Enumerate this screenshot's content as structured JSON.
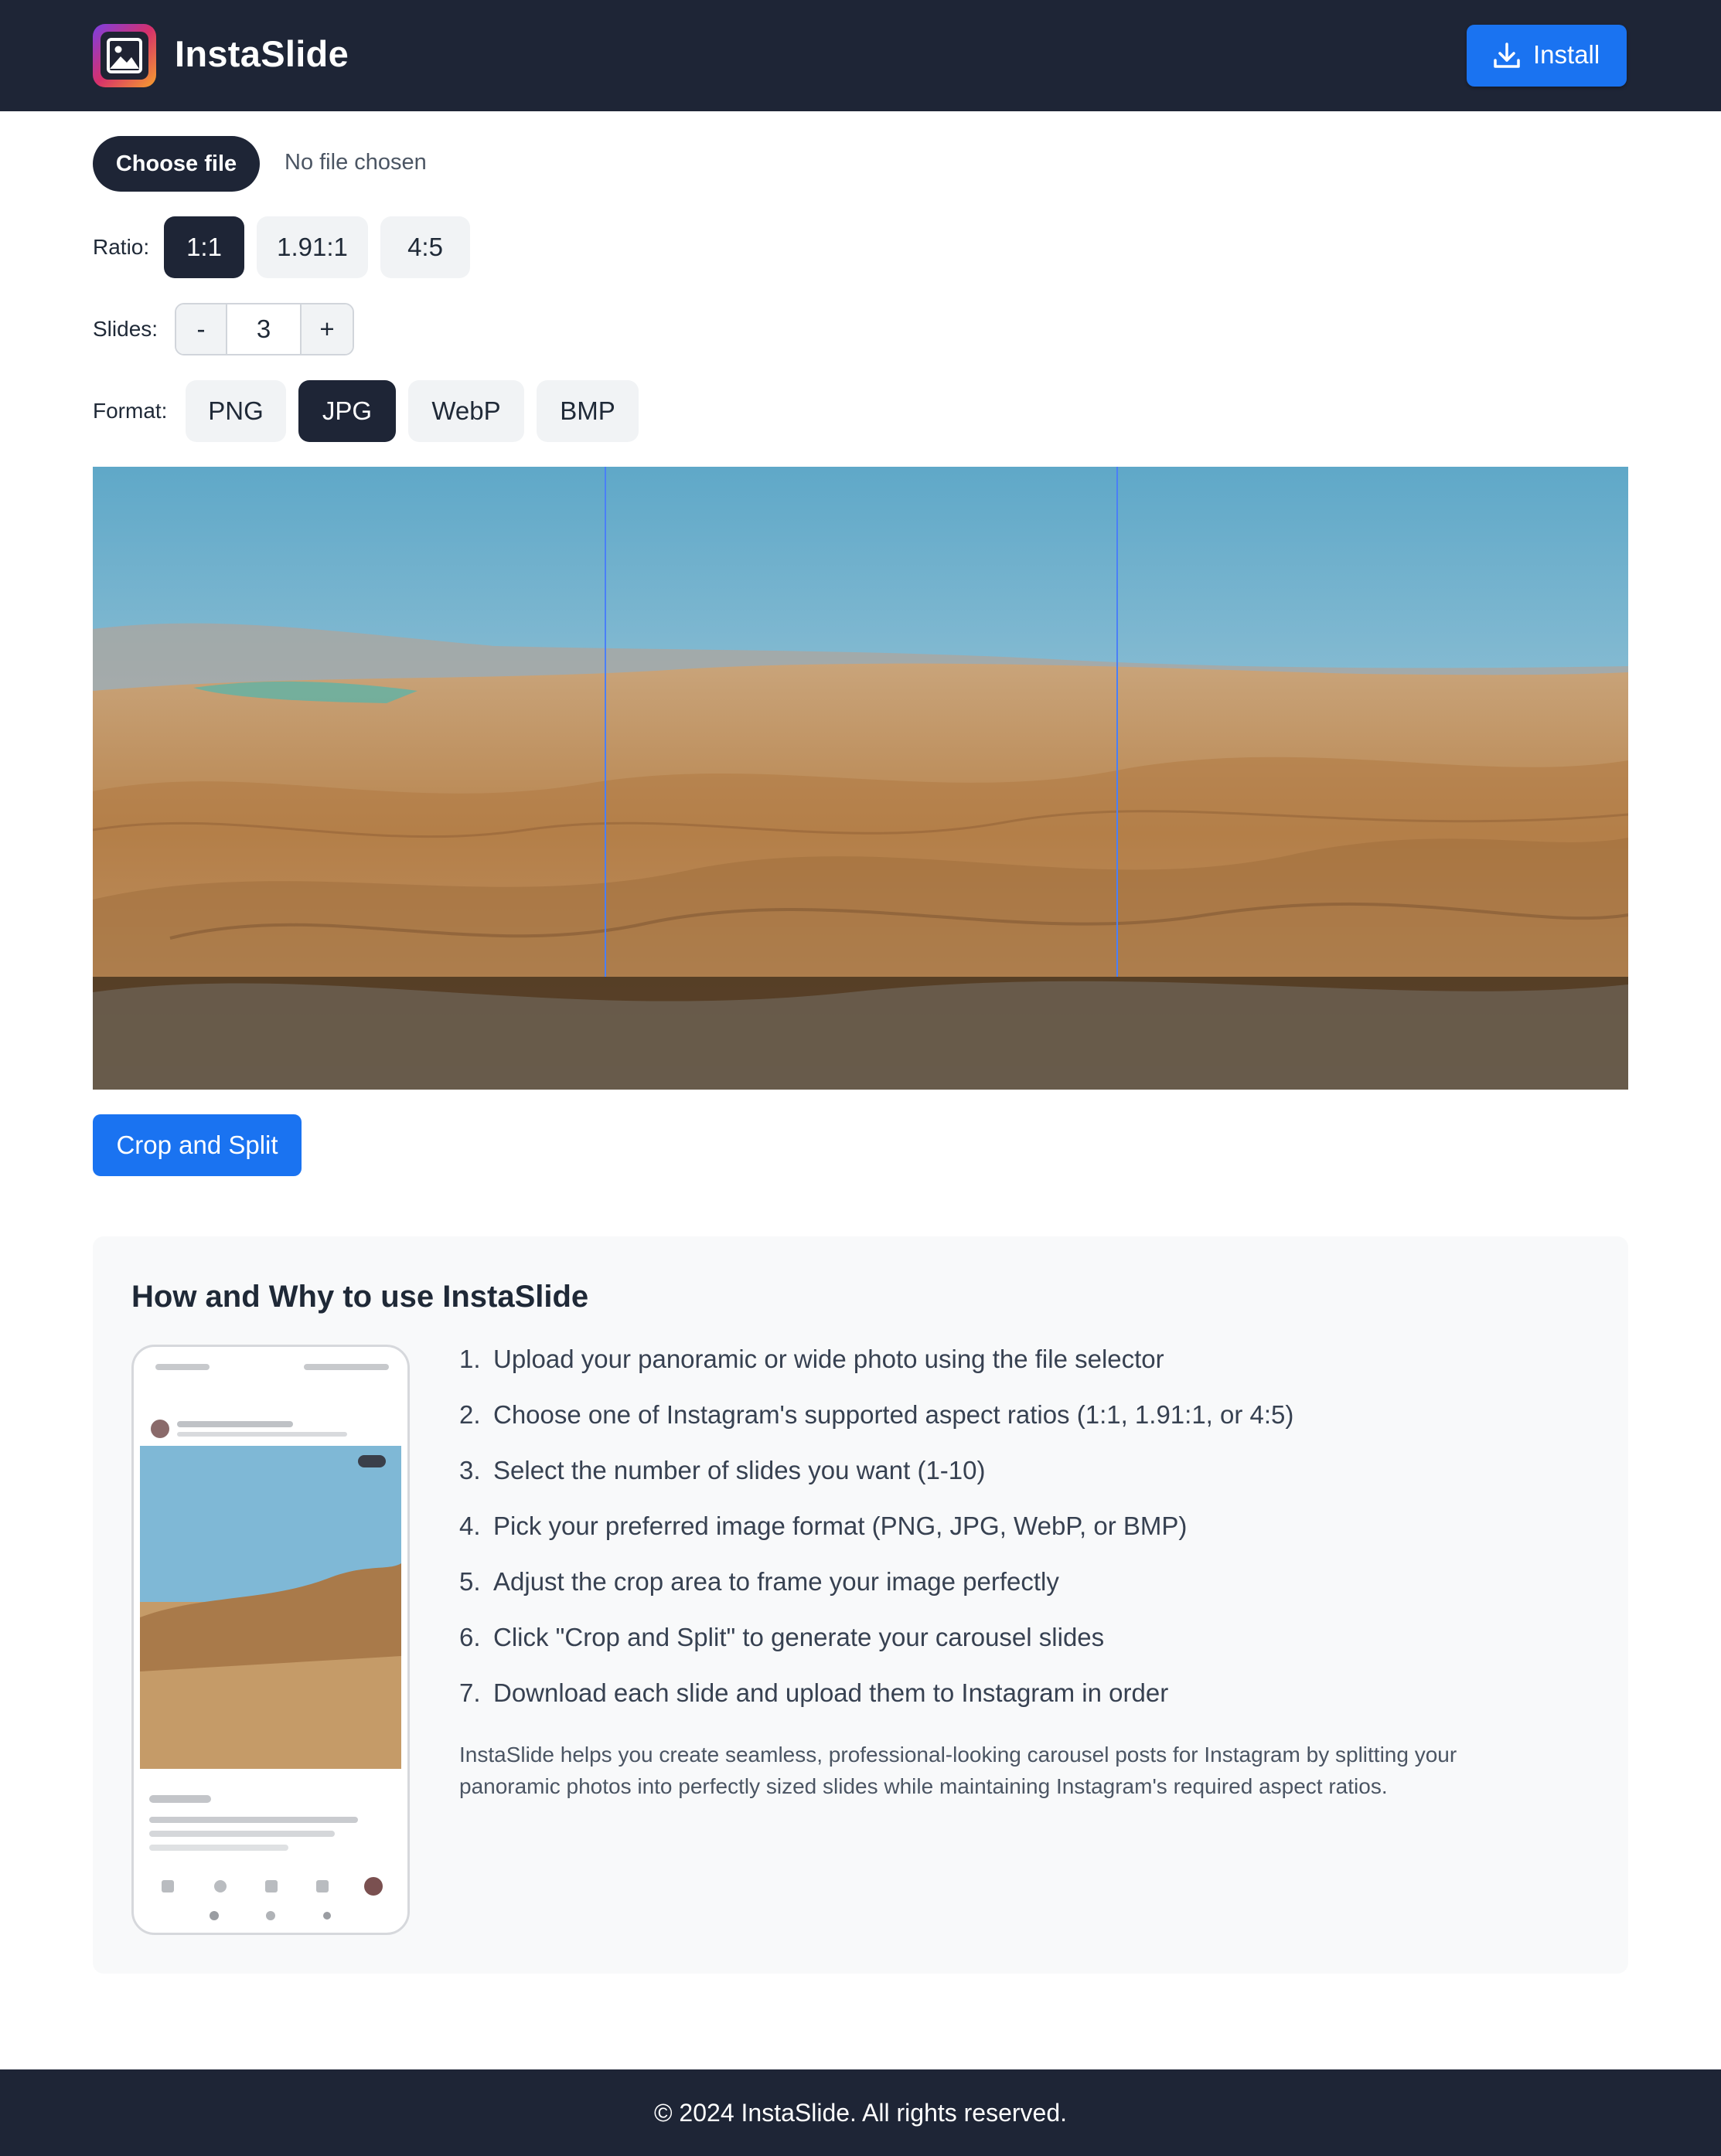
{
  "header": {
    "app_name": "InstaSlide",
    "install_label": "Install",
    "logo_icon": "image-icon",
    "install_icon": "download-icon",
    "colors": {
      "bar": "#1e2536",
      "accent": "#1a73f1"
    }
  },
  "file": {
    "button_label": "Choose file",
    "status": "No file chosen"
  },
  "ratio": {
    "label": "Ratio:",
    "options": [
      "1:1",
      "1.91:1",
      "4:5"
    ],
    "selected": "1:1"
  },
  "slides": {
    "label": "Slides:",
    "minus": "-",
    "value": "3",
    "plus": "+"
  },
  "format": {
    "label": "Format:",
    "options": [
      "PNG",
      "JPG",
      "WebP",
      "BMP"
    ],
    "selected": "JPG"
  },
  "crop_button": "Crop and Split",
  "howto": {
    "title": "How and Why to use InstaSlide",
    "steps": [
      {
        "num": "1.",
        "text": "Upload your panoramic or wide photo using the file selector"
      },
      {
        "num": "2.",
        "text": "Choose one of Instagram's supported aspect ratios (1:1, 1.91:1, or 4:5)"
      },
      {
        "num": "3.",
        "text": "Select the number of slides you want (1-10)"
      },
      {
        "num": "4.",
        "text": "Pick your preferred image format (PNG, JPG, WebP, or BMP)"
      },
      {
        "num": "5.",
        "text": "Adjust the crop area to frame your image perfectly"
      },
      {
        "num": "6.",
        "text": "Click \"Crop and Split\" to generate your carousel slides"
      },
      {
        "num": "7.",
        "text": "Download each slide and upload them to Instagram in order"
      }
    ],
    "description": "InstaSlide helps you create seamless, professional-looking carousel posts for Instagram by splitting your panoramic photos into perfectly sized slides while maintaining Instagram's required aspect ratios."
  },
  "footer": {
    "text": "© 2024 InstaSlide. All rights reserved."
  }
}
